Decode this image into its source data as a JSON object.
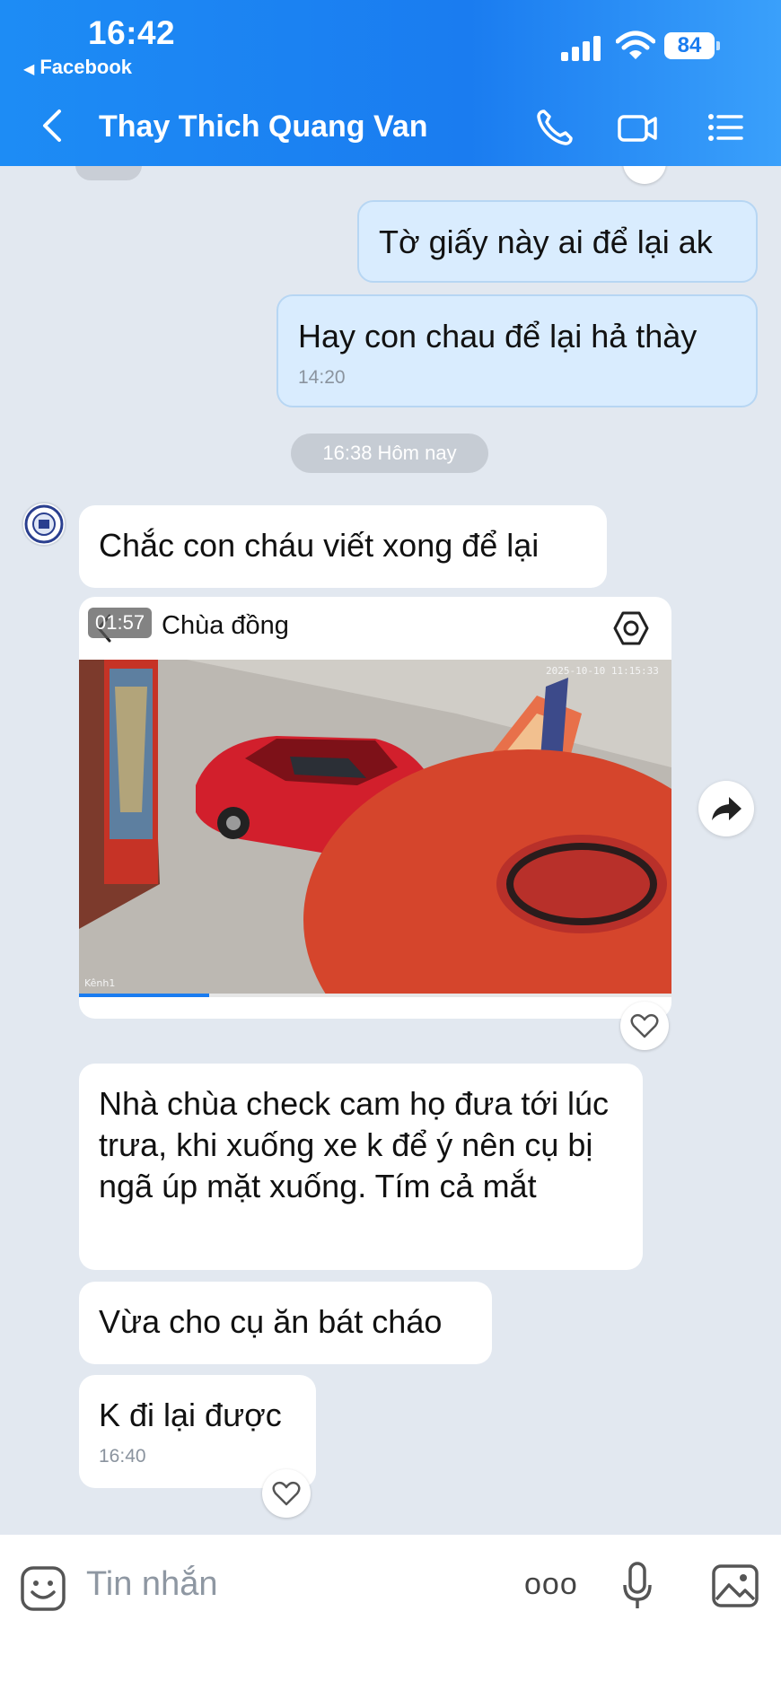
{
  "status_bar": {
    "time": "16:42",
    "back_app": "Facebook",
    "battery": "84"
  },
  "header": {
    "contact_name": "Thay Thich Quang Van",
    "icons": [
      "back-icon",
      "phone-icon",
      "video-call-icon",
      "menu-list-icon"
    ]
  },
  "messages": [
    {
      "from": "me",
      "text": "Tờ giấy này ai để lại ak"
    },
    {
      "from": "me",
      "text": "Hay con chau để lại hả thày",
      "time": "14:20"
    },
    {
      "from": "them",
      "text": "Chắc con cháu viết xong để lại"
    },
    {
      "from": "them",
      "text": "Nhà chùa check cam họ đưa tới lúc trưa, khi xuống xe k để ý nên cụ bị ngã úp mặt xuống. Tím cả mắt"
    },
    {
      "from": "them",
      "text": "Vừa cho cụ ăn bát cháo"
    },
    {
      "from": "them",
      "text": "K đi lại được",
      "time": "16:40"
    }
  ],
  "day_separator": "16:38 Hôm nay",
  "video": {
    "duration": "01:57",
    "title": "Chùa đồng",
    "progress": 0.22
  },
  "composer": {
    "placeholder": "Tin nhắn",
    "more": "ooo"
  },
  "colors": {
    "header": "#1a7cf0",
    "my_bubble": "#d9ecfe",
    "background": "#e2e8f0"
  }
}
